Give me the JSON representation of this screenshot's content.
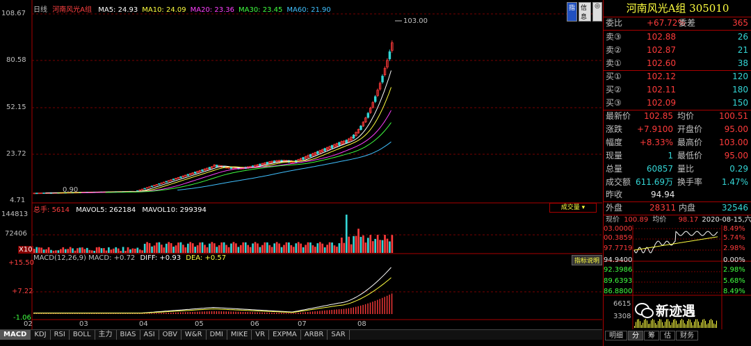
{
  "main": {
    "period_label": "日线",
    "stock_name": "河南风光A组",
    "ma": [
      {
        "label": "MA5: 24.93",
        "color": "#ffffff"
      },
      {
        "label": "MA10: 24.09",
        "color": "#ffff40"
      },
      {
        "label": "MA20: 23.36",
        "color": "#ff40ff"
      },
      {
        "label": "MA30: 23.45",
        "color": "#40ff40"
      },
      {
        "label": "MA60: 21.90",
        "color": "#40c0ff"
      }
    ],
    "y_ticks": [
      "108.67",
      "80.58",
      "52.15",
      "23.72",
      "4.71"
    ],
    "high_label": "103.00",
    "low_label": "0.90",
    "buttons": {
      "index": "指",
      "info": "信息",
      "lock": "◎"
    },
    "volume": {
      "total_label": "总手: ",
      "total_value": "5614",
      "mavol5": "MAVOL5: 262184",
      "mavol10": "MAVOL10: 299394",
      "y_ticks": [
        "144813",
        "72406",
        "X10"
      ],
      "dropdown": "成交量"
    },
    "macd": {
      "title": "MACD(12,26,9) MACD: +0.72",
      "diff": "DIFF: +0.93",
      "dea": "DEA: +0.57",
      "y_ticks": [
        "+15.50",
        "+7.22",
        "-1.06"
      ],
      "explain_button": "指标说明"
    },
    "x_ticks": [
      "02",
      "03",
      "04",
      "05",
      "06",
      "07",
      "08"
    ],
    "tabs": [
      "MACD",
      "KDJ",
      "RSI",
      "BOLL",
      "主力",
      "BIAS",
      "ASI",
      "OBV",
      "W&R",
      "DMI",
      "MIKE",
      "VR",
      "EXPMA",
      "ARBR",
      "SAR"
    ]
  },
  "quote": {
    "title": "河南风光A组 305010",
    "weibi": {
      "label": "委比",
      "value": "+67.72%",
      "label2": "委差",
      "value2": "365"
    },
    "sells": [
      {
        "label": "卖③",
        "price": "102.88",
        "vol": "26"
      },
      {
        "label": "卖②",
        "price": "102.87",
        "vol": "21"
      },
      {
        "label": "卖①",
        "price": "102.60",
        "vol": "38"
      }
    ],
    "buys": [
      {
        "label": "买①",
        "price": "102.12",
        "vol": "120"
      },
      {
        "label": "买②",
        "price": "102.11",
        "vol": "180"
      },
      {
        "label": "买③",
        "price": "102.09",
        "vol": "150"
      }
    ],
    "stats": [
      {
        "l1": "最新价",
        "v1": "102.85",
        "c1": "red",
        "l2": "均价",
        "v2": "100.51",
        "c2": "red"
      },
      {
        "l1": "涨跌",
        "v1": "+7.9100",
        "c1": "red",
        "l2": "开盘价",
        "v2": "95.00",
        "c2": "red"
      },
      {
        "l1": "幅度",
        "v1": "+8.33%",
        "c1": "red",
        "l2": "最高价",
        "v2": "103.00",
        "c2": "red"
      },
      {
        "l1": "现量",
        "v1": "1",
        "c1": "cyan",
        "l2": "最低价",
        "v2": "95.00",
        "c2": "red"
      },
      {
        "l1": "总量",
        "v1": "60857",
        "c1": "cyan",
        "l2": "量比",
        "v2": "0.29",
        "c2": "cyan"
      },
      {
        "l1": "成交额",
        "v1": "611.69万",
        "c1": "cyan",
        "l2": "换手率",
        "v2": "1.47%",
        "c2": "cyan"
      }
    ],
    "prev_close": {
      "label": "昨收",
      "value": "94.94"
    },
    "outer": {
      "label": "外盘",
      "value": "28311",
      "label2": "内盘",
      "value2": "32546"
    },
    "mini": {
      "now_label": "现价",
      "now_value": "100.89",
      "avg_label": "均价",
      "avg_value": "98.17",
      "date": "2020-08-15,六",
      "left_ticks": [
        "03.0000",
        "00.3859",
        "97.7719",
        "94.9400",
        "92.3986",
        "89.6393",
        "86.8800"
      ],
      "right_ticks": [
        "8.49%",
        "5.74%",
        "2.98%",
        "0.00%",
        "2.98%",
        "5.68%",
        "8.49%"
      ],
      "vol_ticks": [
        "6615",
        "3308"
      ]
    },
    "watermark": "新迹遇",
    "bottom_tabs": [
      "明细",
      "分",
      "筹",
      "估",
      "财务"
    ]
  }
}
